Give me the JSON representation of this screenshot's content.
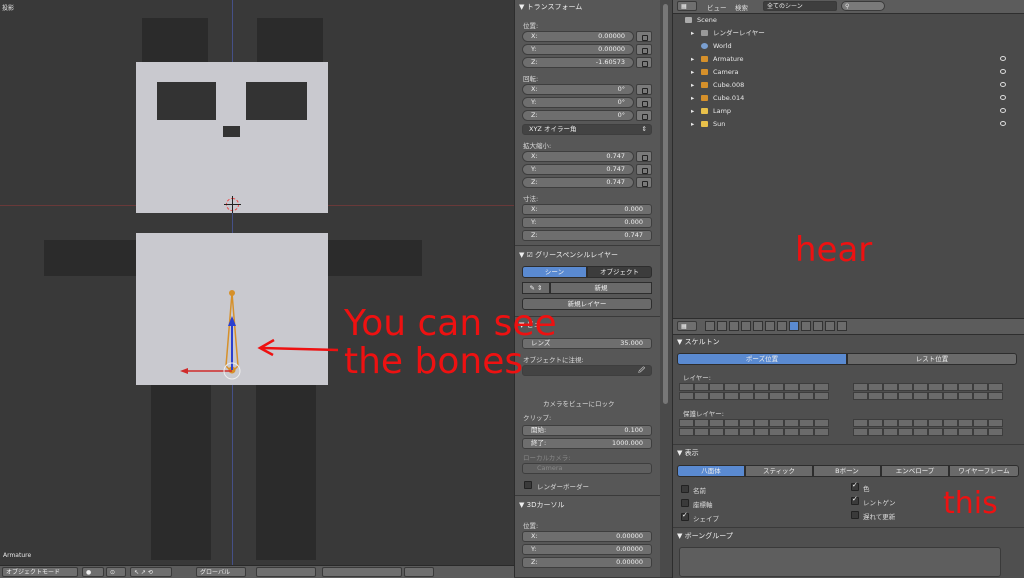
{
  "viewport": {
    "view_label": "投影",
    "object_label": "Armature"
  },
  "vp_header": {
    "mode": "オブジェクトモード",
    "orientation": "グローバル"
  },
  "npanel": {
    "transform_title": "トランスフォーム",
    "location_label": "位置:",
    "location": [
      {
        "k": "X:",
        "v": "0.00000"
      },
      {
        "k": "Y:",
        "v": "0.00000"
      },
      {
        "k": "Z:",
        "v": "-1.60573"
      }
    ],
    "rotation_label": "回転:",
    "rotation": [
      {
        "k": "X:",
        "v": "0°"
      },
      {
        "k": "Y:",
        "v": "0°"
      },
      {
        "k": "Z:",
        "v": "0°"
      }
    ],
    "rotation_mode": "XYZ オイラー角",
    "scale_label": "拡大縮小:",
    "scale": [
      {
        "k": "X:",
        "v": "0.747"
      },
      {
        "k": "Y:",
        "v": "0.747"
      },
      {
        "k": "Z:",
        "v": "0.747"
      }
    ],
    "dimensions_label": "寸法:",
    "dimensions": [
      {
        "k": "X:",
        "v": "0.000"
      },
      {
        "k": "Y:",
        "v": "0.000"
      },
      {
        "k": "Z:",
        "v": "0.747"
      }
    ],
    "grease_title": "グリースペンシルレイヤー",
    "grease_scene": "シーン",
    "grease_object": "オブジェクト",
    "grease_new": "新規",
    "grease_new_layer": "新規レイヤー",
    "view_title": "ビュー",
    "lens_label": "レンズ",
    "lens_value": "35.000",
    "lock_to_object": "オブジェクトに注視:",
    "lock_camera": "カメラをビューにロック",
    "clip_label": "クリップ:",
    "clip_start_k": "開始:",
    "clip_start_v": "0.100",
    "clip_end_k": "終了:",
    "clip_end_v": "1000.000",
    "local_camera": "ローカルカメラ:",
    "camera_name": "Camera",
    "render_border": "レンダーボーダー",
    "cursor_title": "3Dカーソル",
    "cursor_location_label": "位置:",
    "cursor": [
      {
        "k": "X:",
        "v": "0.00000"
      },
      {
        "k": "Y:",
        "v": "0.00000"
      },
      {
        "k": "Z:",
        "v": "0.00000"
      }
    ]
  },
  "outliner": {
    "view_menu": "ビュー",
    "search_menu": "検索",
    "scene_select": "全てのシーン",
    "rows": [
      "Scene",
      "レンダーレイヤー",
      "World",
      "Armature",
      "Camera",
      "Cube.008",
      "Cube.014",
      "Lamp",
      "Sun"
    ]
  },
  "properties": {
    "skeleton_title": "スケルトン",
    "pose_position": "ポーズ位置",
    "rest_position": "レスト位置",
    "layers_label": "レイヤー:",
    "protected_label": "保護レイヤー:",
    "display_title": "表示",
    "display_modes": [
      "八面体",
      "スティック",
      "Bボーン",
      "エンベロープ",
      "ワイヤーフレーム"
    ],
    "opt_names": "名前",
    "opt_axes": "座標軸",
    "opt_shape": "シェイプ",
    "opt_colors": "色",
    "opt_xray": "レントゲン",
    "opt_delay": "遅れて更新",
    "bone_groups_title": "ボーングループ"
  },
  "annotations": {
    "bones_line1": "You can see",
    "bones_line2": "the bones",
    "hear": "hear",
    "this": "this"
  },
  "colors": {
    "annotation": "#ee1111",
    "accent_blue": "#5a8ad1",
    "bone_orange": "#d6902a"
  }
}
